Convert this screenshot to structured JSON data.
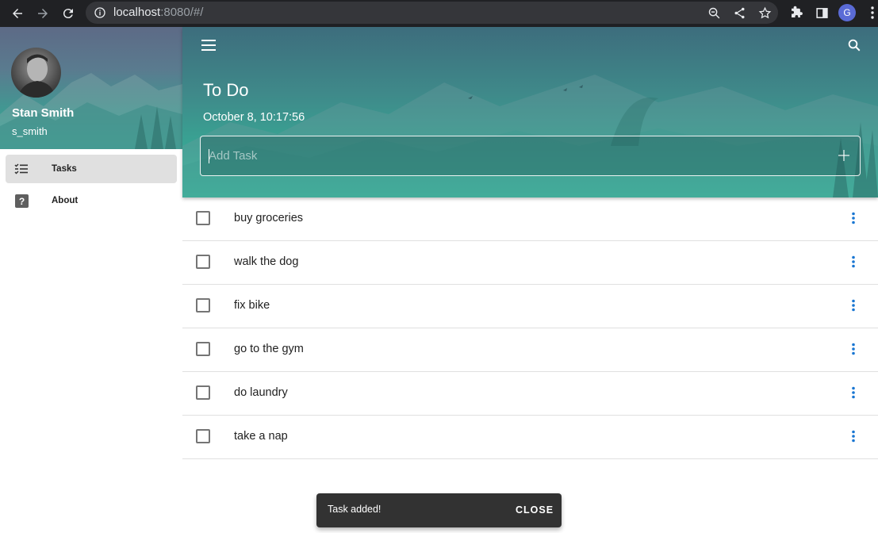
{
  "browser": {
    "url_host": "localhost",
    "url_rest": ":8080/#/",
    "profile_initial": "G",
    "icons": [
      "back-icon",
      "forward-icon",
      "reload-icon",
      "info-icon",
      "zoom-icon",
      "share-icon",
      "star-icon",
      "extensions-icon",
      "side-panel-icon",
      "menu-dots-icon"
    ]
  },
  "sidebar": {
    "user_name": "Stan Smith",
    "user_handle": "s_smith",
    "items": [
      {
        "label": "Tasks",
        "icon": "checklist-icon",
        "active": true
      },
      {
        "label": "About",
        "icon": "help-icon",
        "active": false
      }
    ]
  },
  "header": {
    "title": "To Do",
    "date": "October 8, 10:17:56",
    "add_placeholder": "Add Task"
  },
  "tasks": [
    {
      "label": "buy groceries",
      "done": false
    },
    {
      "label": "walk the dog",
      "done": false
    },
    {
      "label": "fix bike",
      "done": false
    },
    {
      "label": "go to the gym",
      "done": false
    },
    {
      "label": "do laundry",
      "done": false
    },
    {
      "label": "take a nap",
      "done": false
    }
  ],
  "snackbar": {
    "message": "Task added!",
    "action": "CLOSE"
  },
  "colors": {
    "accent": "#1976d2",
    "hero_top": "#3d6d7d",
    "hero_bottom": "#34c8a2"
  }
}
